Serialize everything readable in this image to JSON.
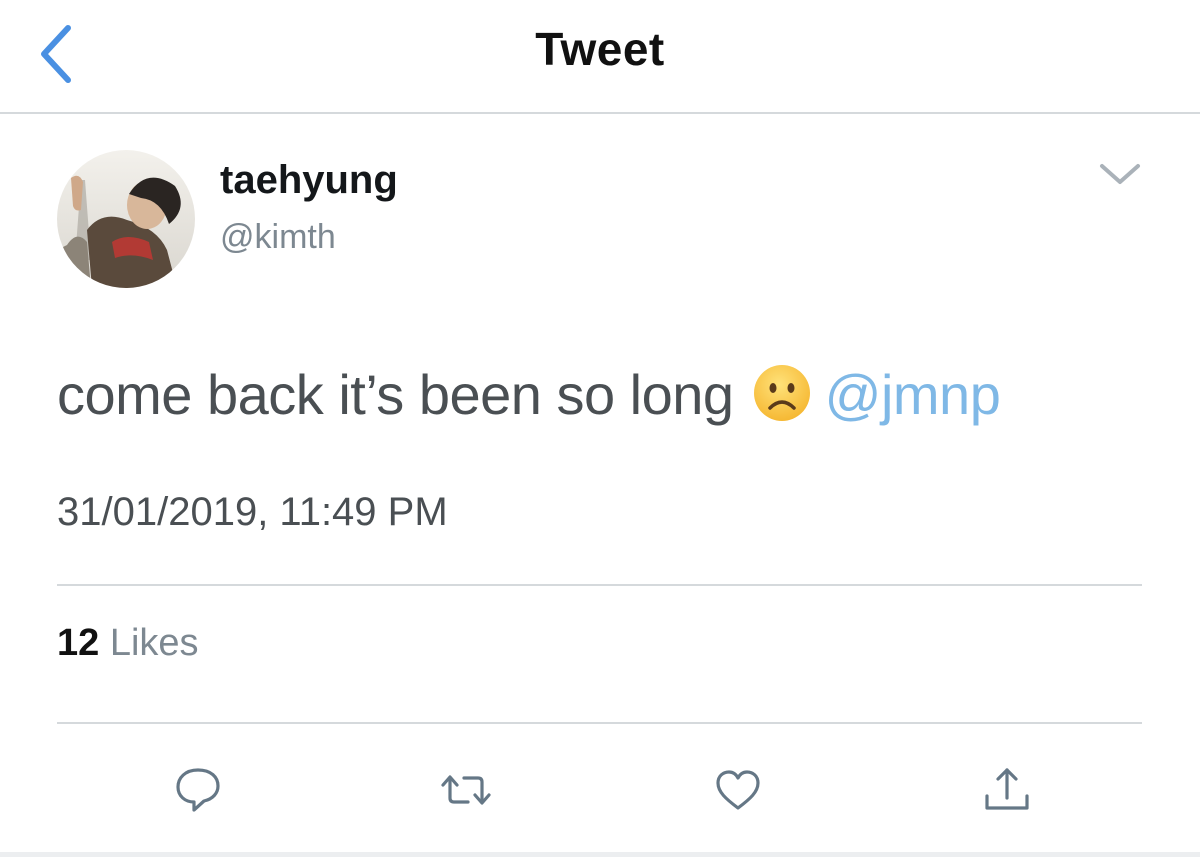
{
  "nav": {
    "title": "Tweet"
  },
  "tweet": {
    "author_name": "taehyung",
    "author_handle": "@kimth",
    "text": "come back it’s been so long",
    "mention": "@jmnp",
    "timestamp": "31/01/2019, 11:49 PM",
    "likes_count": "12",
    "likes_label": "Likes"
  },
  "colors": {
    "accent": "#7fb8e6",
    "text_primary": "#14171a",
    "text_secondary": "#7d8891",
    "divider": "#d5d9dc"
  },
  "icons": [
    "back-chevron-icon",
    "caret-down-icon",
    "sad-face-emoji",
    "reply-icon",
    "retweet-icon",
    "like-heart-icon",
    "share-icon"
  ]
}
